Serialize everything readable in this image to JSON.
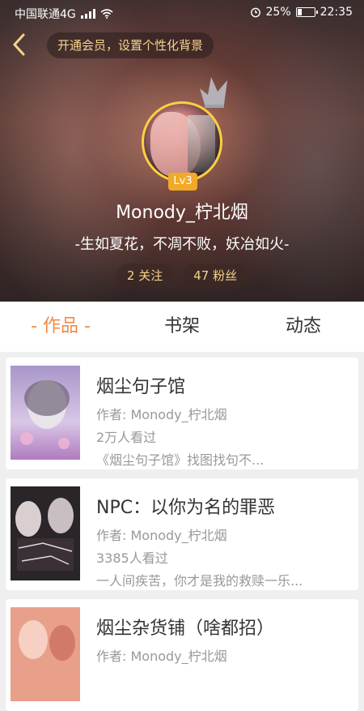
{
  "status_bar": {
    "carrier": "中国联通4G",
    "network_sup": "4G",
    "battery": "25%",
    "time": "22:35",
    "icons": [
      "signal-icon",
      "wifi-icon",
      "alarm-icon",
      "battery-icon"
    ]
  },
  "header": {
    "back_icon": "chevron-left-icon",
    "vip_prompt": "开通会员，设置个性化背景"
  },
  "profile": {
    "level": "Lv3",
    "nickname": "Monody_柠北烟",
    "signature": "-生如夏花，不凋不败，妖冶如火-",
    "following": "2 关注",
    "followers": "47 粉丝"
  },
  "tabs": [
    {
      "label": "- 作品 -",
      "active": true
    },
    {
      "label": "书架",
      "active": false
    },
    {
      "label": "动态",
      "active": false
    }
  ],
  "works": [
    {
      "title": "烟尘句子馆",
      "author": "作者: Monody_柠北烟",
      "views": "2万人看过",
      "desc": "《烟尘句子馆》找图找句不..."
    },
    {
      "title": "NPC：以你为名的罪恶",
      "author": "作者: Monody_柠北烟",
      "views": "3385人看过",
      "desc": "一人间疾苦，你才是我的救赎一乐..."
    },
    {
      "title": "烟尘杂货铺（啥都招）",
      "author": "作者: Monody_柠北烟",
      "views": "",
      "desc": ""
    }
  ],
  "colors": {
    "accent": "#f08a46",
    "gold": "#f6d38a",
    "level_badge": "#f3a928"
  }
}
